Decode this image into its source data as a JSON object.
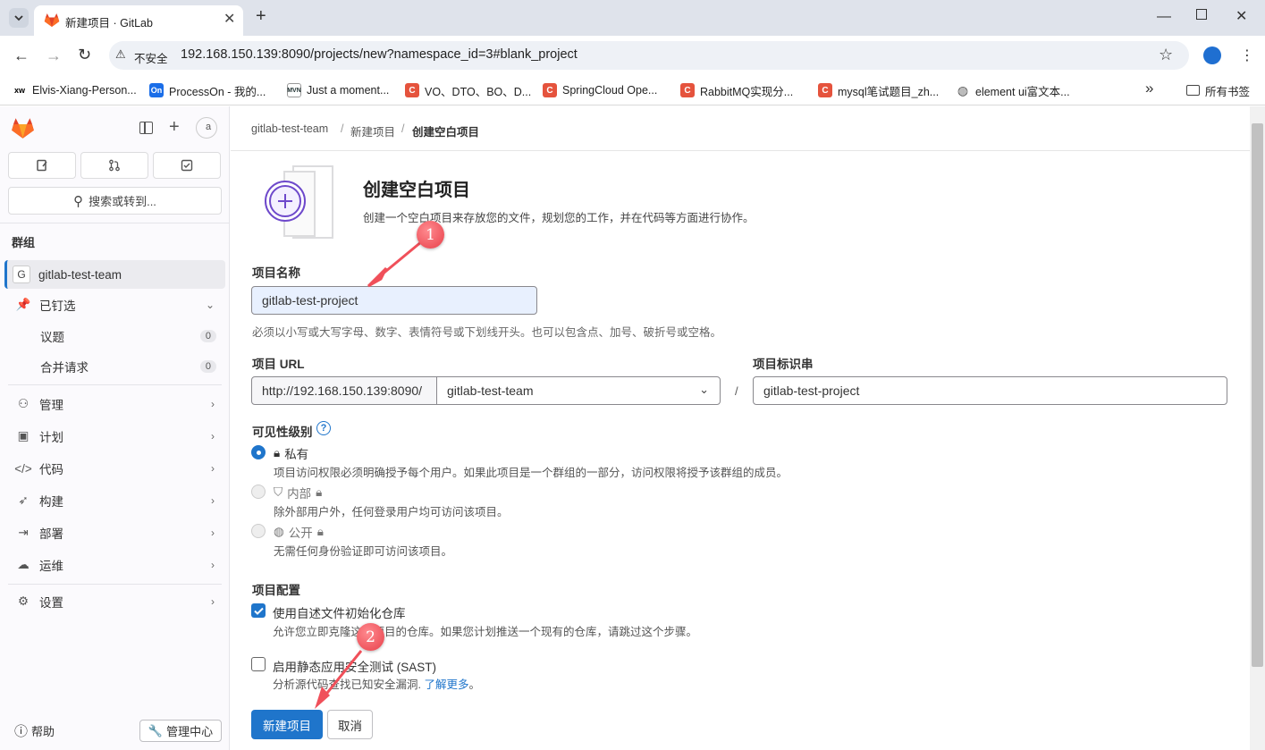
{
  "browser": {
    "tab_title": "新建项目 · GitLab",
    "security_label": "不安全",
    "url": "192.168.150.139:8090/projects/new?namespace_id=3#blank_project",
    "bookmarks": [
      {
        "label": "Elvis-Xiang-Person...",
        "icon": "xw"
      },
      {
        "label": "ProcessOn - 我的...",
        "icon": "On"
      },
      {
        "label": "Just a moment...",
        "icon": "MVN"
      },
      {
        "label": "VO、DTO、BO、D...",
        "icon": "C"
      },
      {
        "label": "SpringCloud Ope...",
        "icon": "C"
      },
      {
        "label": "RabbitMQ实现分...",
        "icon": "C"
      },
      {
        "label": "mysql笔试题目_zh...",
        "icon": "C"
      },
      {
        "label": "element ui富文本...",
        "icon": "globe"
      }
    ],
    "more_bookmarks": "»",
    "all_bookmarks": "所有书签"
  },
  "sidebar": {
    "search_placeholder": "搜索或转到...",
    "section": "群组",
    "group": {
      "avatar": "G",
      "name": "gitlab-test-team"
    },
    "pinned": "已钉选",
    "pinned_items": [
      {
        "label": "议题",
        "count": "0"
      },
      {
        "label": "合并请求",
        "count": "0"
      }
    ],
    "nav": [
      "管理",
      "计划",
      "代码",
      "构建",
      "部署",
      "运维"
    ],
    "settings": "设置",
    "help": "帮助",
    "admin": "管理中心",
    "avatar_alt": "a"
  },
  "breadcrumb": [
    "gitlab-test-team",
    "新建项目",
    "创建空白项目"
  ],
  "page": {
    "title": "创建空白项目",
    "subtitle": "创建一个空白项目来存放您的文件，规划您的工作，并在代码等方面进行协作。",
    "name_label": "项目名称",
    "name_value": "gitlab-test-project",
    "name_help": "必须以小写或大写字母、数字、表情符号或下划线开头。也可以包含点、加号、破折号或空格。",
    "url_label": "项目 URL",
    "url_prefix": "http://192.168.150.139:8090/",
    "namespace": "gitlab-test-team",
    "slash": "/",
    "slug_label": "项目标识串",
    "slug_value": "gitlab-test-project",
    "visibility_label": "可见性级别",
    "visibility": [
      {
        "title": "私有",
        "desc": "项目访问权限必须明确授予每个用户。如果此项目是一个群组的一部分，访问权限将授予该群组的成员。",
        "selected": true
      },
      {
        "title": "内部",
        "desc": "除外部用户外，任何登录用户均可访问该项目。",
        "selected": false
      },
      {
        "title": "公开",
        "desc": "无需任何身份验证即可访问该项目。",
        "selected": false
      }
    ],
    "config_label": "项目配置",
    "readme_label": "使用自述文件初始化仓库",
    "readme_desc": "允许您立即克隆这个项目的仓库。如果您计划推送一个现有的仓库，请跳过这个步骤。",
    "sast_label": "启用静态应用安全测试 (SAST)",
    "sast_desc": "分析源代码查找已知安全漏洞.",
    "sast_link": "了解更多",
    "sast_period": "。",
    "create_button": "新建项目",
    "cancel_button": "取消"
  },
  "annotations": [
    "1",
    "2"
  ],
  "colors": {
    "primary": "#1f75cb",
    "annotation": "#f0505a",
    "purple": "#6e49cb"
  }
}
